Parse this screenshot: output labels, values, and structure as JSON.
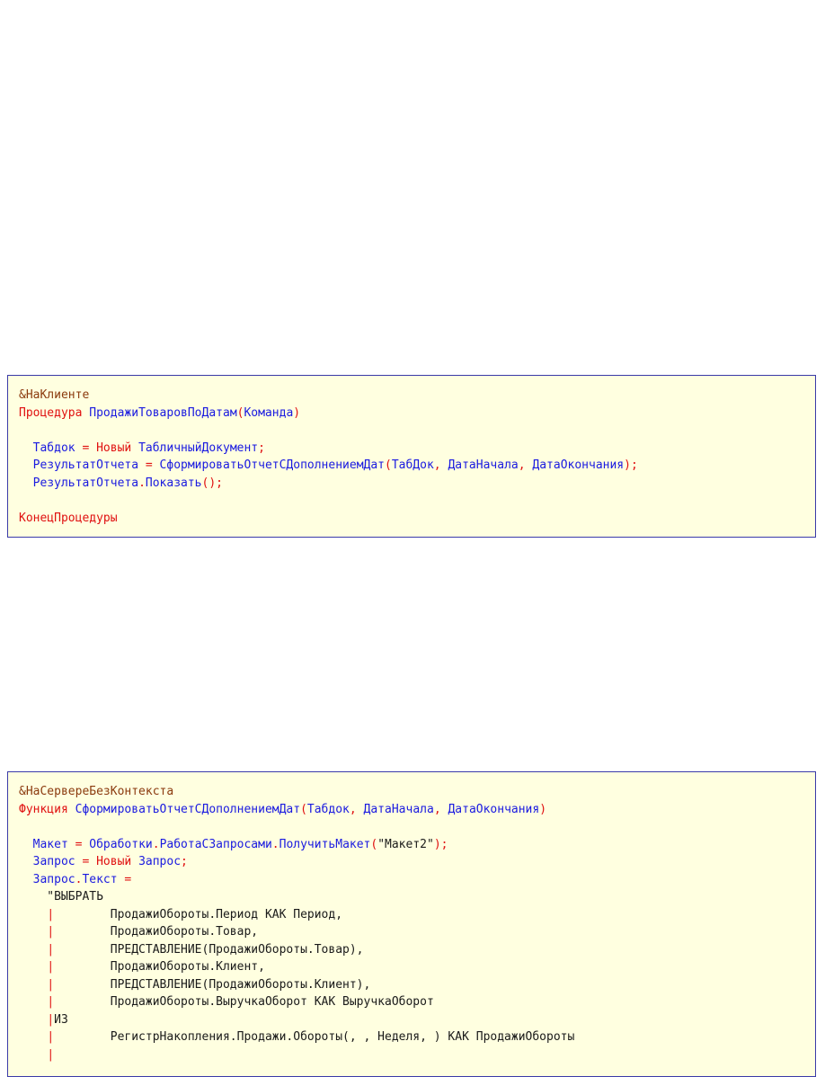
{
  "colors": {
    "keyword": "#e01010",
    "identifier": "#1a1ae0",
    "directive": "#8b3a0e",
    "text": "#1a1a1a",
    "box_bg": "#ffffe0",
    "box_border": "#3a3aa8"
  },
  "blocks": [
    {
      "lines": [
        [
          [
            "&НаКлиенте",
            "brown"
          ]
        ],
        [
          [
            "Процедура",
            "red"
          ],
          [
            " ",
            "black"
          ],
          [
            "ПродажиТоваровПоДатам",
            "blue"
          ],
          [
            "(",
            "red"
          ],
          [
            "Команда",
            "blue"
          ],
          [
            ")",
            "red"
          ]
        ],
        [],
        [
          [
            "  ",
            "black"
          ],
          [
            "Табдок",
            "blue"
          ],
          [
            " = ",
            "red"
          ],
          [
            "Новый",
            "red"
          ],
          [
            " ",
            "black"
          ],
          [
            "ТабличныйДокумент",
            "blue"
          ],
          [
            ";",
            "red"
          ]
        ],
        [
          [
            "  ",
            "black"
          ],
          [
            "РезультатОтчета",
            "blue"
          ],
          [
            " = ",
            "red"
          ],
          [
            "СформироватьОтчетСДополнениемДат",
            "blue"
          ],
          [
            "(",
            "red"
          ],
          [
            "ТабДок",
            "blue"
          ],
          [
            ", ",
            "red"
          ],
          [
            "ДатаНачала",
            "blue"
          ],
          [
            ", ",
            "red"
          ],
          [
            "ДатаОкончания",
            "blue"
          ],
          [
            ");",
            "red"
          ]
        ],
        [
          [
            "  ",
            "black"
          ],
          [
            "РезультатОтчета",
            "blue"
          ],
          [
            ".",
            "red"
          ],
          [
            "Показать",
            "blue"
          ],
          [
            "();",
            "red"
          ]
        ],
        [],
        [
          [
            "КонецПроцедуры",
            "red"
          ]
        ]
      ]
    },
    {
      "lines": [
        [
          [
            "&НаСервереБезКонтекста",
            "brown"
          ]
        ],
        [
          [
            "Функция",
            "red"
          ],
          [
            " ",
            "black"
          ],
          [
            "СформироватьОтчетСДополнениемДат",
            "blue"
          ],
          [
            "(",
            "red"
          ],
          [
            "Табдок",
            "blue"
          ],
          [
            ", ",
            "red"
          ],
          [
            "ДатаНачала",
            "blue"
          ],
          [
            ", ",
            "red"
          ],
          [
            "ДатаОкончания",
            "blue"
          ],
          [
            ")",
            "red"
          ]
        ],
        [],
        [
          [
            "  ",
            "black"
          ],
          [
            "Макет",
            "blue"
          ],
          [
            " = ",
            "red"
          ],
          [
            "Обработки",
            "blue"
          ],
          [
            ".",
            "red"
          ],
          [
            "РаботаСЗапросами",
            "blue"
          ],
          [
            ".",
            "red"
          ],
          [
            "ПолучитьМакет",
            "blue"
          ],
          [
            "(",
            "red"
          ],
          [
            "\"Макет2\"",
            "black"
          ],
          [
            ");",
            "red"
          ]
        ],
        [
          [
            "  ",
            "black"
          ],
          [
            "Запрос",
            "blue"
          ],
          [
            " = ",
            "red"
          ],
          [
            "Новый",
            "red"
          ],
          [
            " ",
            "black"
          ],
          [
            "Запрос",
            "blue"
          ],
          [
            ";",
            "red"
          ]
        ],
        [
          [
            "  ",
            "black"
          ],
          [
            "Запрос",
            "blue"
          ],
          [
            ".",
            "red"
          ],
          [
            "Текст",
            "blue"
          ],
          [
            " =",
            "red"
          ]
        ],
        [
          [
            "    \"ВЫБРАТЬ",
            "black"
          ]
        ],
        [
          [
            "    ",
            "black"
          ],
          [
            "|",
            "red"
          ],
          [
            "        ПродажиОбороты.Период КАК Период,",
            "black"
          ]
        ],
        [
          [
            "    ",
            "black"
          ],
          [
            "|",
            "red"
          ],
          [
            "        ПродажиОбороты.Товар,",
            "black"
          ]
        ],
        [
          [
            "    ",
            "black"
          ],
          [
            "|",
            "red"
          ],
          [
            "        ПРЕДСТАВЛЕНИЕ(ПродажиОбороты.Товар),",
            "black"
          ]
        ],
        [
          [
            "    ",
            "black"
          ],
          [
            "|",
            "red"
          ],
          [
            "        ПродажиОбороты.Клиент,",
            "black"
          ]
        ],
        [
          [
            "    ",
            "black"
          ],
          [
            "|",
            "red"
          ],
          [
            "        ПРЕДСТАВЛЕНИЕ(ПродажиОбороты.Клиент),",
            "black"
          ]
        ],
        [
          [
            "    ",
            "black"
          ],
          [
            "|",
            "red"
          ],
          [
            "        ПродажиОбороты.ВыручкаОборот КАК ВыручкаОборот",
            "black"
          ]
        ],
        [
          [
            "    ",
            "black"
          ],
          [
            "|",
            "red"
          ],
          [
            "ИЗ",
            "black"
          ]
        ],
        [
          [
            "    ",
            "black"
          ],
          [
            "|",
            "red"
          ],
          [
            "        РегистрНакопления.Продажи.Обороты(, , Неделя, ) КАК ПродажиОбороты",
            "black"
          ]
        ],
        [
          [
            "    ",
            "black"
          ],
          [
            "|",
            "red"
          ]
        ]
      ]
    }
  ]
}
